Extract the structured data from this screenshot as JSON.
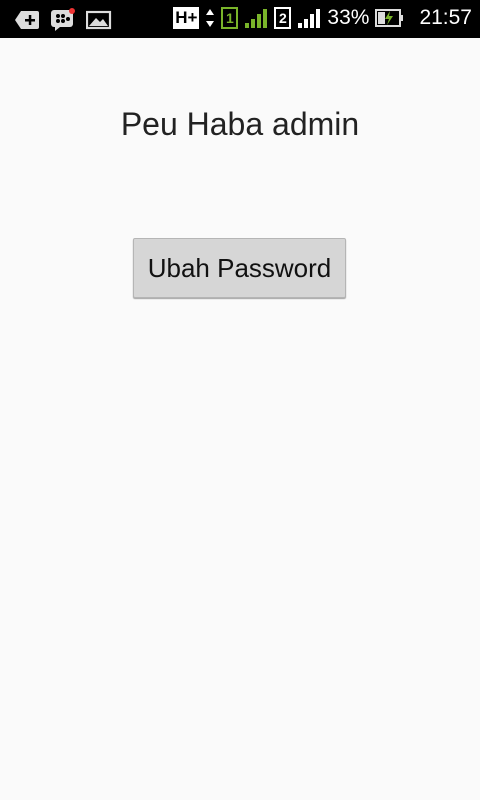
{
  "status_bar": {
    "network_label": "H+",
    "sim1_label": "1",
    "sim2_label": "2",
    "battery_percent": "33%",
    "time": "21:57",
    "icons": [
      "add-icon",
      "bbm-icon",
      "gallery-icon",
      "data-arrows-icon",
      "signal-icon",
      "signal-icon",
      "battery-charging-icon"
    ],
    "colors": {
      "sim1_accent": "#7ab52a"
    }
  },
  "screen": {
    "title": "Peu Haba admin",
    "change_password_button": "Ubah Password"
  }
}
